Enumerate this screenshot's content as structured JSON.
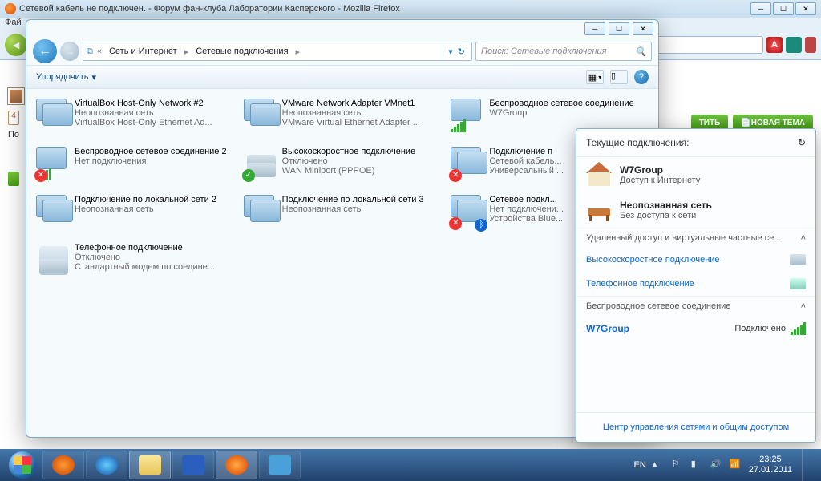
{
  "firefox": {
    "title": "Сетевой кабель не подключен. - Форум фан-клуба Лаборатории Касперского - Mozilla Firefox",
    "menu_file_prefix": "Фай"
  },
  "page_buttons": {
    "reply": "ТИТЬ",
    "new_topic": "НОВАЯ ТЕМА"
  },
  "explorer": {
    "breadcrumb": [
      "Сеть и Интернет",
      "Сетевые подключения"
    ],
    "search_placeholder": "Поиск: Сетевые подключения",
    "organize": "Упорядочить",
    "connections": [
      {
        "name": "VirtualBox Host-Only Network #2",
        "status": "Неопознанная сеть",
        "device": "VirtualBox Host-Only Ethernet Ad...",
        "icon": "adapter"
      },
      {
        "name": "VMware Network Adapter VMnet1",
        "status": "Неопознанная сеть",
        "device": "VMware Virtual Ethernet Adapter ...",
        "icon": "adapter"
      },
      {
        "name": "Беспроводное сетевое соединение",
        "status": "W7Group",
        "device": "",
        "icon": "wifi"
      },
      {
        "name": "Беспроводное сетевое соединение 2",
        "status": "Нет подключения",
        "device": "",
        "icon": "wifi-x"
      },
      {
        "name": "Высокоскоростное подключение",
        "status": "Отключено",
        "device": "WAN Miniport (PPPOE)",
        "icon": "broadband-ok"
      },
      {
        "name": "Подключение п",
        "status": "Сетевой кабель...",
        "device": "Универсальный ...",
        "icon": "lan-x"
      },
      {
        "name": "Подключение по локальной сети 2",
        "status": "Неопознанная сеть",
        "device": "",
        "icon": "lan"
      },
      {
        "name": "Подключение по локальной сети 3",
        "status": "Неопознанная сеть",
        "device": "",
        "icon": "lan"
      },
      {
        "name": "Сетевое подкл...",
        "status": "Нет подключени...",
        "device": "Устройства Blue...",
        "icon": "bt-x"
      },
      {
        "name": "Телефонное подключение",
        "status": "Отключено",
        "device": "Стандартный модем по соедине...",
        "icon": "dialup"
      }
    ]
  },
  "flyout": {
    "heading": "Текущие подключения:",
    "networks": [
      {
        "name": "W7Group",
        "desc": "Доступ к Интернету",
        "icon": "home"
      },
      {
        "name": "Неопознанная сеть",
        "desc": "Без доступа к сети",
        "icon": "bench"
      }
    ],
    "section_remote": "Удаленный доступ и виртуальные частные се...",
    "links": [
      "Высокоскоростное подключение",
      "Телефонное подключение"
    ],
    "section_wifi": "Беспроводное сетевое соединение",
    "wifi": {
      "name": "W7Group",
      "state": "Подключено"
    },
    "footer": "Центр управления сетями и общим доступом"
  },
  "tray": {
    "lang": "EN",
    "time": "23:25",
    "date": "27.01.2011"
  },
  "page_side": {
    "count": "4",
    "label_po": "По"
  }
}
